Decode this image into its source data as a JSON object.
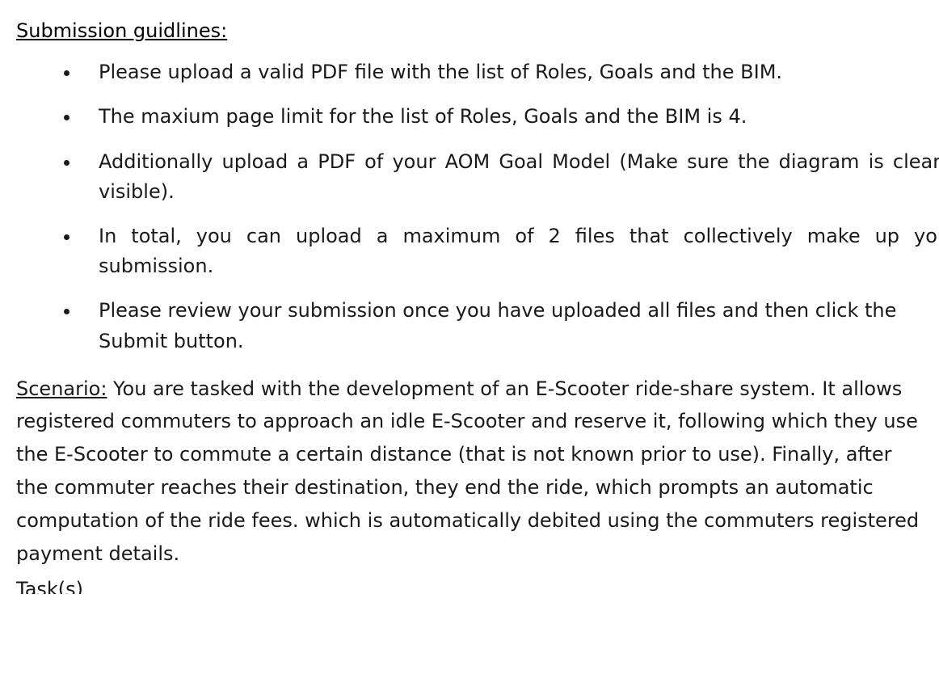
{
  "guidelines": {
    "heading": "Submission guidlines:",
    "items": [
      "Please upload a valid PDF file with the list of Roles, Goals and the BIM.",
      "The maxium page limit for the list of Roles, Goals and the BIM is 4.",
      "Additionally upload a PDF of your AOM Goal Model (Make sure the diagram is clearly visible).",
      "In total, you can upload a maximum of 2 files that collectively make up your submission.",
      "Please review your submission once you have uploaded all files and then click the Submit button."
    ]
  },
  "scenario": {
    "label": "Scenario:",
    "body": " You are tasked with the development of an E-Scooter ride-share system. It allows registered commuters to approach an idle E-Scooter and reserve it, following which they use the E-Scooter to commute a certain distance (that is not known prior to use). Finally, after the commuter reaches their destination,  they end the ride, which prompts an automatic computation of the ride fees. which is automatically debited using the commuters registered payment details."
  },
  "task_stub": "Task(s)"
}
